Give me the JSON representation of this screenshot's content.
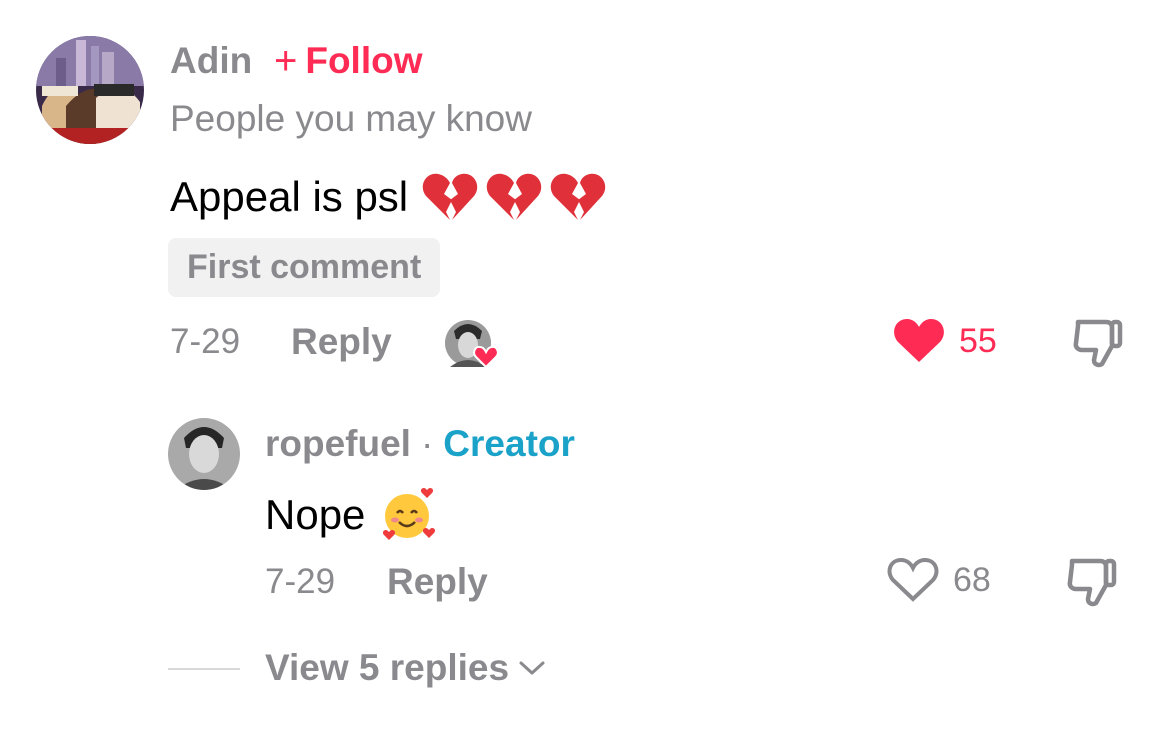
{
  "comment": {
    "username": "Adin",
    "follow_plus": "+",
    "follow_label": "Follow",
    "subtitle": "People you may know",
    "text": "Appeal is psl",
    "emojis": [
      "broken-heart",
      "broken-heart",
      "broken-heart"
    ],
    "badge": "First comment",
    "date": "7-29",
    "reply_label": "Reply",
    "like_count": "55",
    "liked": true
  },
  "reply": {
    "username": "ropefuel",
    "separator": "·",
    "role": "Creator",
    "text": "Nope",
    "emoji": "smiling-face-with-hearts",
    "date": "7-29",
    "reply_label": "Reply",
    "like_count": "68",
    "liked": false
  },
  "view_replies": {
    "label": "View 5 replies",
    "icon": "chevron-down-icon"
  },
  "colors": {
    "accent": "#fe2c55",
    "muted": "#8a8a8e",
    "creator": "#1ba2c9",
    "badge_bg": "#f1f1f2"
  }
}
